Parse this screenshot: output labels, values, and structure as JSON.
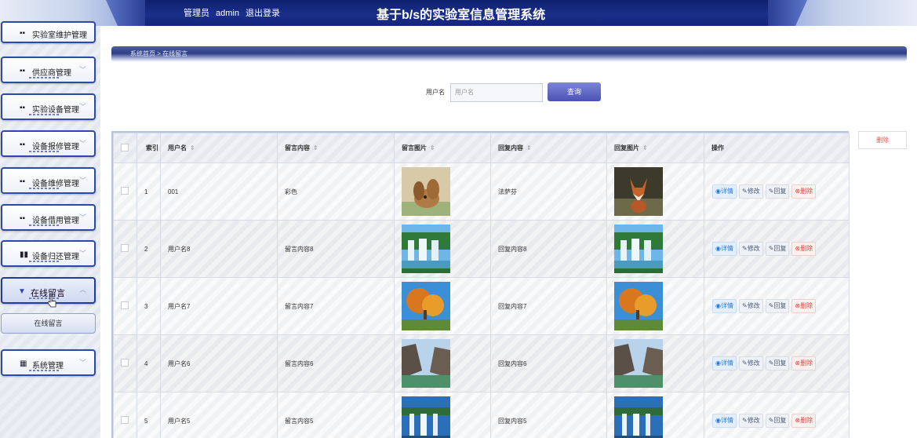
{
  "header": {
    "role": "管理员",
    "username": "admin",
    "logout": "退出登录",
    "title": "基于b/s的实验室信息管理系统"
  },
  "sidebar": {
    "items": [
      {
        "label": "实验室维护管理",
        "icon": "grid-icon"
      },
      {
        "label": "供应商管理",
        "icon": "grid-icon"
      },
      {
        "label": "实验设备管理",
        "icon": "grid-icon"
      },
      {
        "label": "设备报修管理",
        "icon": "grid-icon"
      },
      {
        "label": "设备维修管理",
        "icon": "grid-icon"
      },
      {
        "label": "设备借用管理",
        "icon": "grid-icon"
      },
      {
        "label": "设备归还管理",
        "icon": "bar-chart-icon"
      },
      {
        "label": "在线留言",
        "icon": "funnel-icon"
      },
      {
        "label": "系统管理",
        "icon": "table-icon"
      }
    ],
    "sub_item": "在线留言"
  },
  "breadcrumb": {
    "text": "系统首页 > 在线留言"
  },
  "search": {
    "label": "用户名",
    "placeholder": "用户名",
    "button": "查询"
  },
  "delete_all": "删除",
  "table": {
    "headers": [
      "索引",
      "用户名",
      "留言内容",
      "留言图片",
      "回复内容",
      "回复图片",
      "操作"
    ],
    "actions": {
      "detail": "详情",
      "edit": "修改",
      "reply": "回复",
      "delete": "删除"
    },
    "rows": [
      {
        "index": "1",
        "username": "001",
        "content": "彩色",
        "image": "rabbit",
        "reply": "法萨芬",
        "reply_image": "fox"
      },
      {
        "index": "2",
        "username": "用户名8",
        "content": "留言内容8",
        "image": "waterfall",
        "reply": "回复内容8",
        "reply_image": "waterfall"
      },
      {
        "index": "3",
        "username": "用户名7",
        "content": "留言内容7",
        "image": "autumn",
        "reply": "回复内容7",
        "reply_image": "autumn"
      },
      {
        "index": "4",
        "username": "用户名6",
        "content": "留言内容6",
        "image": "canyon",
        "reply": "回复内容6",
        "reply_image": "canyon"
      },
      {
        "index": "5",
        "username": "用户名5",
        "content": "留言内容5",
        "image": "falls",
        "reply": "回复内容5",
        "reply_image": "falls"
      }
    ]
  }
}
